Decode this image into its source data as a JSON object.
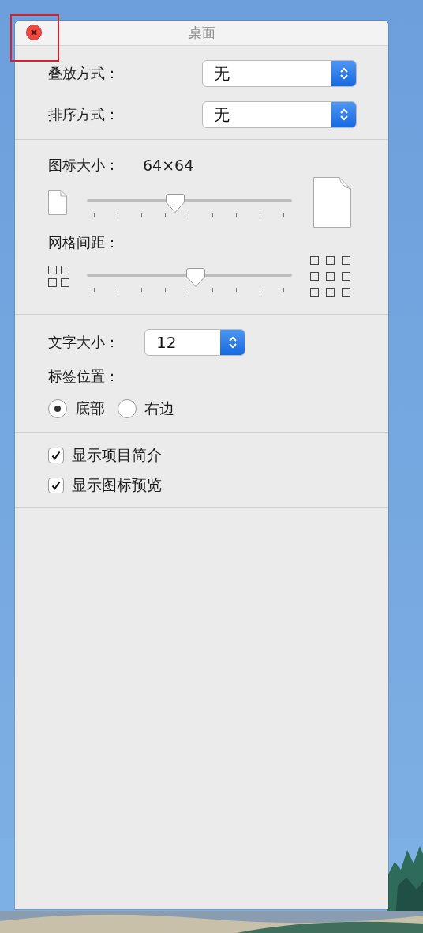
{
  "window": {
    "title": "桌面",
    "close_button": {
      "highlighted": true
    }
  },
  "popups": [
    {
      "label": "叠放方式：",
      "value": "无"
    },
    {
      "label": "排序方式：",
      "value": "无"
    }
  ],
  "sliders": [
    {
      "kind": "icon_size",
      "label": "图标大小：",
      "reading": "64×64",
      "level": 0.43
    },
    {
      "kind": "grid",
      "label": "网格间距：",
      "level": 0.53
    }
  ],
  "text_size": {
    "label": "文字大小：",
    "value": "12"
  },
  "label_position": {
    "label": "标签位置：",
    "options": [
      {
        "label": "底部",
        "selected": true
      },
      {
        "label": "右边",
        "selected": false
      }
    ]
  },
  "checkboxes": [
    {
      "label": "显示项目简介",
      "checked": true
    },
    {
      "label": "显示图标预览",
      "checked": true
    }
  ]
}
